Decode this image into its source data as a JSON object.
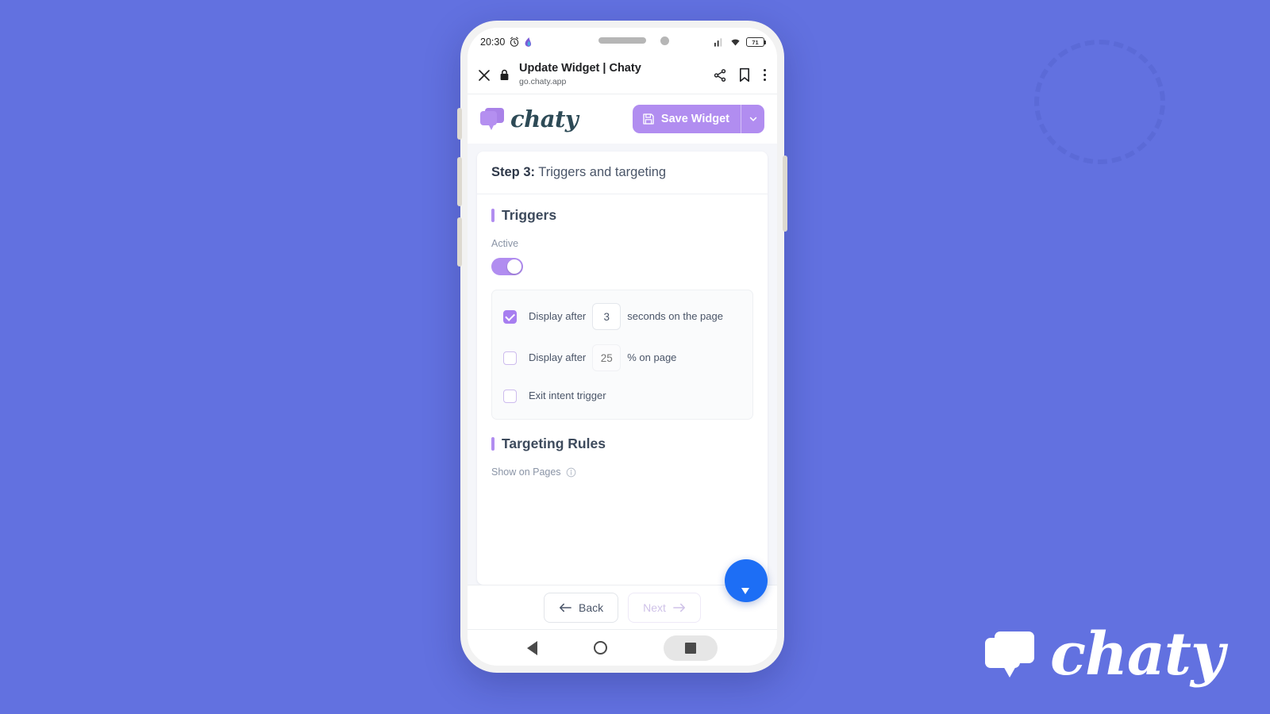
{
  "background": {
    "color": "#6271e0",
    "accent": "#5a69d6"
  },
  "watermark": {
    "brand": "chaty",
    "icon": "chat-bubble-icon"
  },
  "phone": {
    "statusbar": {
      "time": "20:30",
      "alarm_icon": "alarm-clock-icon",
      "app_icon": "app-notification-icon",
      "signal_icon": "cellular-signal-icon",
      "wifi_icon": "wifi-icon",
      "battery_level": "71"
    },
    "browser": {
      "close_icon": "close-icon",
      "lock_icon": "lock-icon",
      "title": "Update Widget | Chaty",
      "url": "go.chaty.app",
      "share_icon": "share-icon",
      "bookmark_icon": "bookmark-icon",
      "menu_icon": "overflow-menu-icon"
    },
    "android_nav": {
      "back_icon": "back-triangle-icon",
      "home_icon": "home-circle-icon",
      "recents_icon": "recents-square-icon"
    }
  },
  "app": {
    "logo_text": "chaty",
    "logo_icon": "chaty-logo-icon",
    "save_button": {
      "label": "Save Widget",
      "icon": "save-floppy-icon",
      "caret_icon": "chevron-down-icon",
      "color": "#b18df0"
    }
  },
  "wizard": {
    "step_prefix": "Step 3:",
    "step_title": " Triggers and targeting"
  },
  "triggers": {
    "section_title": "Triggers",
    "active_label": "Active",
    "active_enabled": true,
    "rules": [
      {
        "checked": true,
        "text_before": "Display after",
        "value": "3",
        "text_after": "seconds on the page",
        "has_input": true
      },
      {
        "checked": false,
        "text_before": "Display after",
        "value": "25",
        "text_after": "% on page",
        "has_input": true
      },
      {
        "checked": false,
        "text_before": "Exit intent trigger",
        "value": "",
        "text_after": "",
        "has_input": false
      }
    ]
  },
  "targeting": {
    "section_title": "Targeting Rules",
    "show_on_pages_label": "Show on Pages",
    "info_icon": "info-circle-icon"
  },
  "footer": {
    "back_label": "Back",
    "back_icon": "arrow-left-icon",
    "next_label": "Next",
    "next_icon": "arrow-right-icon",
    "next_disabled": true,
    "chat_fab_icon": "chat-bubble-icon",
    "chat_fab_color": "#1d6ef5"
  }
}
